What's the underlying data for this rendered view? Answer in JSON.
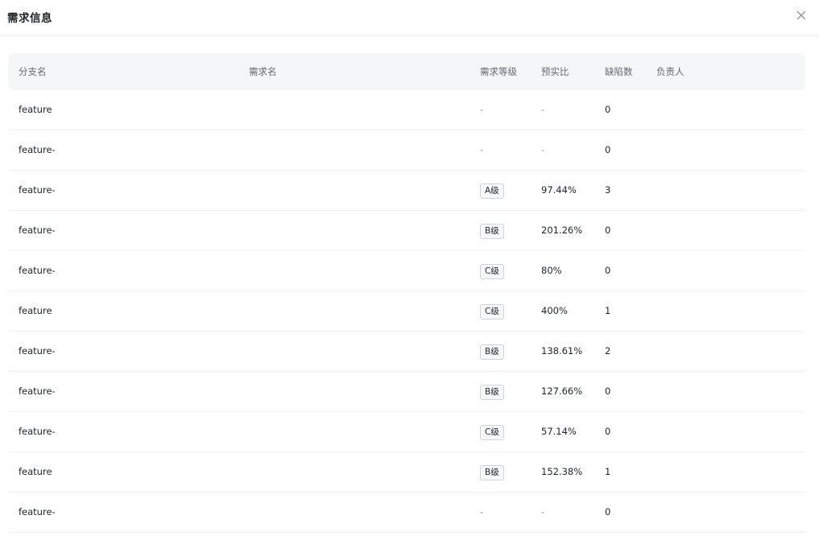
{
  "dialog": {
    "title": "需求信息"
  },
  "table": {
    "columns": {
      "branch": "分支名",
      "requirement": "需求名",
      "level": "需求等级",
      "ratio": "预实比",
      "defects": "缺陷数",
      "owner": "负责人"
    },
    "rows": [
      {
        "branch": "feature",
        "requirement": "",
        "level": "-",
        "ratio": "-",
        "defects": "0",
        "owner": ""
      },
      {
        "branch": "feature-",
        "requirement": "",
        "level": "-",
        "ratio": "-",
        "defects": "0",
        "owner": ""
      },
      {
        "branch": "feature-",
        "requirement": "",
        "level": "A级",
        "ratio": "97.44%",
        "defects": "3",
        "owner": ""
      },
      {
        "branch": "feature-",
        "requirement": "",
        "level": "B级",
        "ratio": "201.26%",
        "defects": "0",
        "owner": ""
      },
      {
        "branch": "feature-",
        "requirement": "",
        "level": "C级",
        "ratio": "80%",
        "defects": "0",
        "owner": ""
      },
      {
        "branch": "feature",
        "requirement": "",
        "level": "C级",
        "ratio": "400%",
        "defects": "1",
        "owner": ""
      },
      {
        "branch": "feature-",
        "requirement": "",
        "level": "B级",
        "ratio": "138.61%",
        "defects": "2",
        "owner": ""
      },
      {
        "branch": "feature-",
        "requirement": "",
        "level": "B级",
        "ratio": "127.66%",
        "defects": "0",
        "owner": ""
      },
      {
        "branch": "feature-",
        "requirement": "",
        "level": "C级",
        "ratio": "57.14%",
        "defects": "0",
        "owner": ""
      },
      {
        "branch": "feature",
        "requirement": "",
        "level": "B级",
        "ratio": "152.38%",
        "defects": "1",
        "owner": ""
      },
      {
        "branch": "feature-",
        "requirement": "",
        "level": "-",
        "ratio": "-",
        "defects": "0",
        "owner": ""
      }
    ]
  },
  "icons": {
    "close": "close-icon"
  }
}
